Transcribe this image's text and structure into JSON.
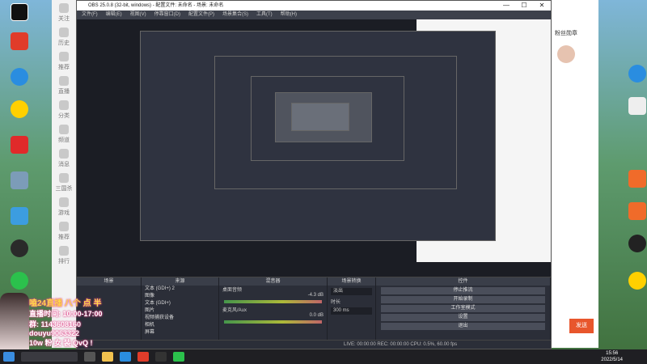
{
  "obs": {
    "title": "OBS 25.0.8 (32-bit, windows) - 配置文件: 未命名 - 场景: 未命名",
    "window_controls": [
      "—",
      "☐",
      "✕"
    ],
    "menu": [
      "文件(F)",
      "编辑(E)",
      "视图(V)",
      "停靠窗口(D)",
      "配置文件(P)",
      "场景集合(S)",
      "工具(T)",
      "帮助(H)"
    ],
    "docks": {
      "scenes_header": "场景",
      "sources_header": "来源",
      "mixer_header": "混音器",
      "transitions_header": "场景转换",
      "controls_header": "控件"
    },
    "sources": [
      "文本 (GDI+) 2",
      "图像",
      "文本 (GDI+)",
      "图片",
      "视频捕获设备",
      "相机",
      "屏幕"
    ],
    "mixer": {
      "track1_label": "桌面音频",
      "track1_db": "-4.3 dB",
      "track2_label": "麦克风/Aux",
      "track2_db": "0.0 dB"
    },
    "transitions": {
      "type": "淡出",
      "duration_label": "时长",
      "duration_value": "300 ms"
    },
    "controls": [
      "停止推流",
      "开始录制",
      "工作室模式",
      "设置",
      "退出"
    ],
    "status": "LIVE: 00:00:00  REC: 00:00:00  CPU: 0.5%, 60.00 fps"
  },
  "overlay": {
    "line1": "嗑24直播 八个 点 半",
    "line2": "直播时间: 10:00-17:00",
    "line3": "群: 1143608160",
    "line4": "douyu9063322",
    "line5": "10w 粉 女 装 QvQ !"
  },
  "sidenav": [
    "关注",
    "历史",
    "推荐",
    "直播",
    "分类",
    "频道",
    "消息",
    "三国杀",
    "游戏",
    "推荐",
    "排行"
  ],
  "chatpanel": {
    "header": "粉丝勋章",
    "button": "发送"
  },
  "taskbar": {
    "time": "15:56",
    "date": "2022/5/14"
  },
  "colors": {
    "obs_bg": "#2b2e38",
    "accent": "#e8562c"
  }
}
